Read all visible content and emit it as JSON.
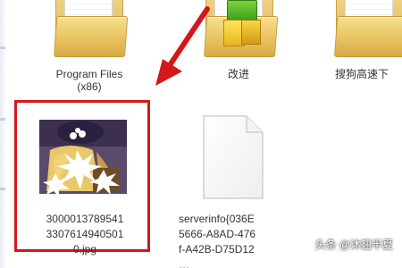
{
  "items": [
    {
      "label_line1": "Program Files",
      "label_line2": "(x86)"
    },
    {
      "label": "改进"
    },
    {
      "label": "搜狗高速下"
    }
  ],
  "selected_item": {
    "label_line1": "3000013789541",
    "label_line2": "3307614940501",
    "label_line3": "0.jpg"
  },
  "server_file": {
    "label_line1": "serverinfo{036E",
    "label_line2": "5666-A8AD-476",
    "label_line3": "f-A42B-D75D12",
    "label_line4": "…"
  },
  "watermark": {
    "text": "头条 @沐翘半夏"
  },
  "colors": {
    "selection_border": "#d4171b",
    "arrow": "#d4171b",
    "folder": "#e6bf5f"
  },
  "icons": {
    "folder": "folder-icon",
    "file": "file-icon",
    "image": "image-thumbnail-icon",
    "arrow": "red-arrow-icon"
  }
}
